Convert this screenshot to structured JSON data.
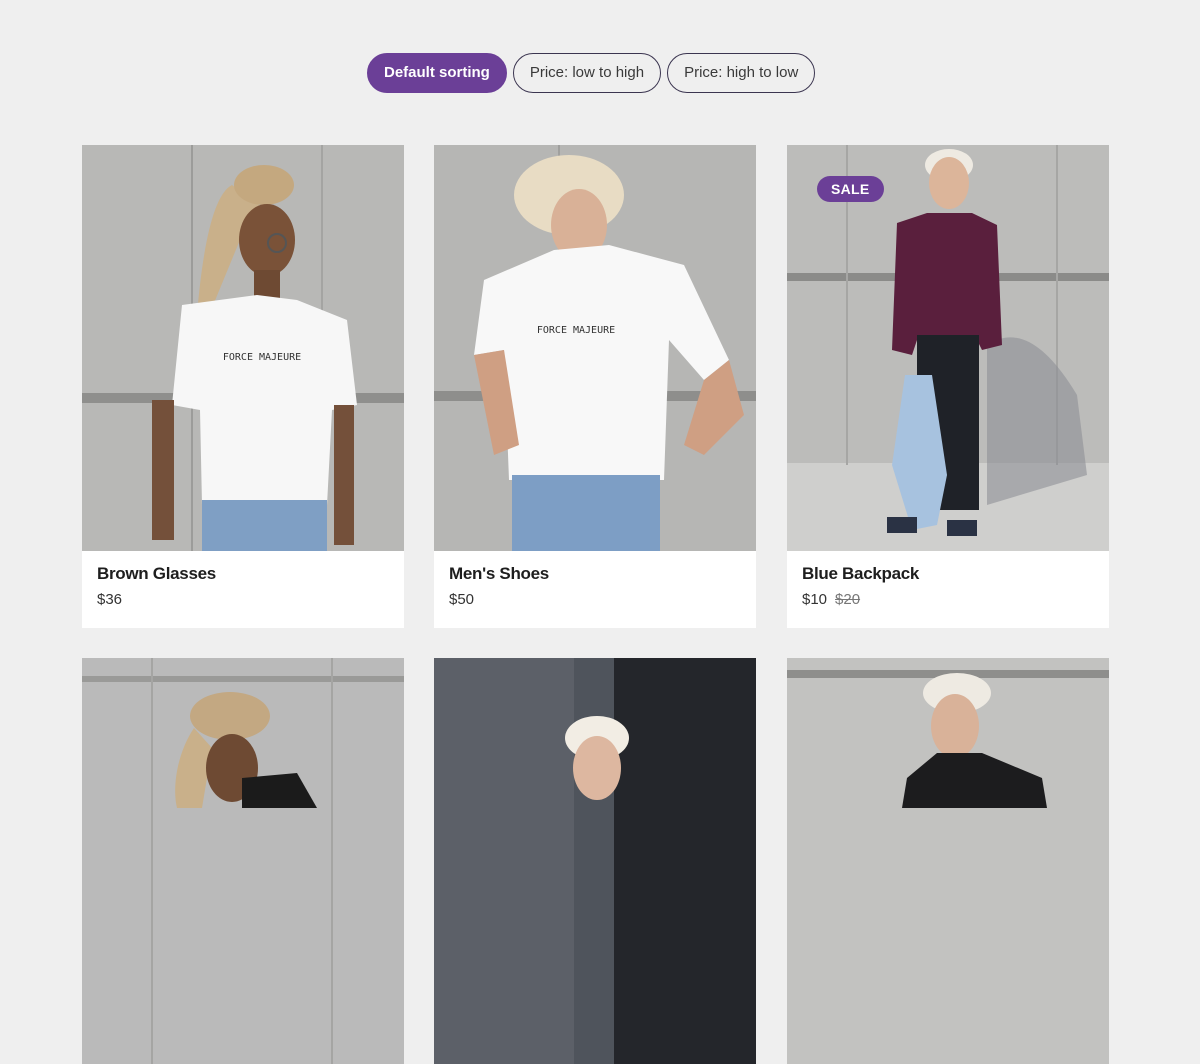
{
  "sorting": {
    "buttons": [
      {
        "label": "Default sorting",
        "active": true
      },
      {
        "label": "Price: low to high",
        "active": false
      },
      {
        "label": "Price: high to low",
        "active": false
      }
    ]
  },
  "products": [
    {
      "name": "Brown Glasses",
      "price": "$36",
      "image_icon": "model-photo"
    },
    {
      "name": "Men's Shoes",
      "price": "$50",
      "image_icon": "model-photo"
    },
    {
      "name": "Blue Backpack",
      "price": "$10",
      "old_price": "$20",
      "badge": "SALE",
      "image_icon": "model-photo"
    },
    {
      "image_icon": "model-photo"
    },
    {
      "image_icon": "model-photo"
    },
    {
      "image_icon": "model-photo"
    }
  ],
  "shirt_print": "FORCE MAJEURE",
  "colors": {
    "accent": "#6b3f97",
    "background": "#efefef",
    "card": "#ffffff"
  }
}
